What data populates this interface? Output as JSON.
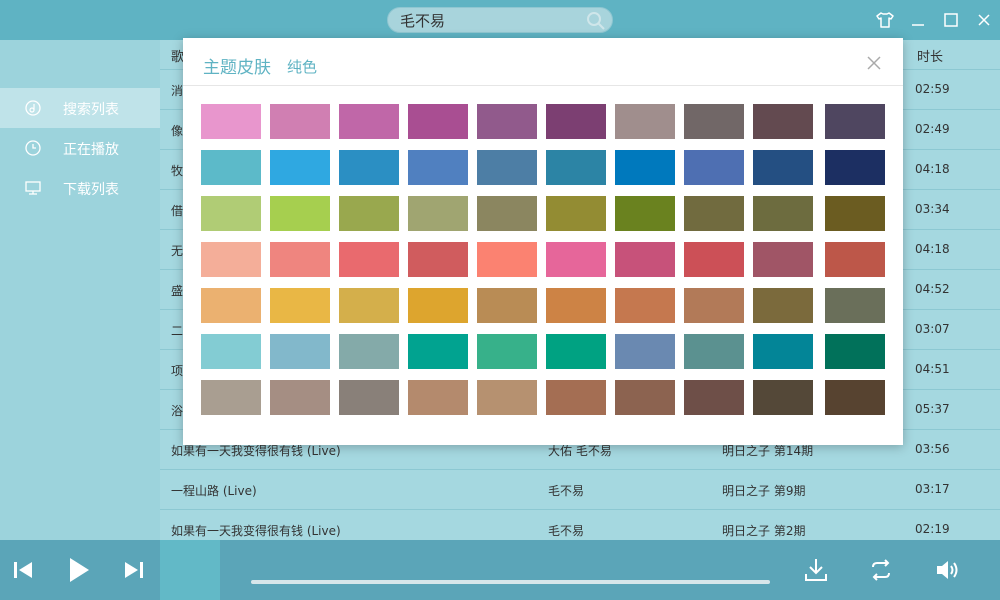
{
  "search": {
    "value": "毛不易"
  },
  "sidebar": {
    "items": [
      {
        "label": "搜索列表"
      },
      {
        "label": "正在播放"
      },
      {
        "label": "下载列表"
      }
    ]
  },
  "table": {
    "headers": {
      "song": "歌",
      "duration": "时长"
    },
    "rows": [
      {
        "title": "消",
        "artist": "",
        "album": "",
        "duration": "02:59"
      },
      {
        "title": "像",
        "artist": "",
        "album": "",
        "duration": "02:49"
      },
      {
        "title": "牧",
        "artist": "",
        "album": "",
        "duration": "04:18"
      },
      {
        "title": "借",
        "artist": "",
        "album": "",
        "duration": "03:34"
      },
      {
        "title": "无",
        "artist": "",
        "album": "",
        "duration": "04:18"
      },
      {
        "title": "盛",
        "artist": "",
        "album": "",
        "duration": "04:52"
      },
      {
        "title": "二",
        "artist": "",
        "album": "",
        "duration": "03:07"
      },
      {
        "title": "项",
        "artist": "",
        "album": "",
        "duration": "04:51"
      },
      {
        "title": "浴",
        "artist": "",
        "album": "",
        "duration": "05:37"
      },
      {
        "title": "如果有一天我变得很有钱 (Live)",
        "artist": "大佑 毛不易",
        "album": "明日之子 第14期",
        "duration": "03:56"
      },
      {
        "title": "一程山路 (Live)",
        "artist": "毛不易",
        "album": "明日之子 第9期",
        "duration": "03:17"
      },
      {
        "title": "如果有一天我变得很有钱 (Live)",
        "artist": "毛不易",
        "album": "明日之子 第2期",
        "duration": "02:19"
      }
    ]
  },
  "modal": {
    "title": "主题皮肤",
    "subtitle": "纯色",
    "swatches": [
      [
        "#e896cd",
        "#d07fb2",
        "#c067a8",
        "#a94e92",
        "#915a8c",
        "#7c3f72",
        "#a08e8d",
        "#716767",
        "#634a50",
        "#4f4660"
      ],
      [
        "#5cbac9",
        "#2fa8e1",
        "#2b8fc3",
        "#5080c0",
        "#4d7ea5",
        "#2c84a5",
        "#0079bd",
        "#4e6fb2",
        "#244f82",
        "#1c2f62"
      ],
      [
        "#b0cc75",
        "#a6cf4f",
        "#99a84e",
        "#a0a571",
        "#8b8660",
        "#938c33",
        "#6a821f",
        "#716b3f",
        "#6d6c3f",
        "#6b5c21"
      ],
      [
        "#f4ae99",
        "#ef857f",
        "#e96a6e",
        "#d05c5e",
        "#fb8271",
        "#e6669a",
        "#c7527a",
        "#cc5057",
        "#a05566",
        "#bd5749"
      ],
      [
        "#ebb170",
        "#e9b745",
        "#d4af4b",
        "#dda52e",
        "#b98c55",
        "#cd8345",
        "#c5784f",
        "#b27a58",
        "#7b6a3c",
        "#6a6f5a"
      ],
      [
        "#83ccd3",
        "#82b8cb",
        "#84aaa9",
        "#01a390",
        "#37b18a",
        "#00a282",
        "#6a89b1",
        "#5b9190",
        "#038597",
        "#01715a"
      ],
      [
        "#a99e91",
        "#a58e83",
        "#898079",
        "#b48a6d",
        "#b69170",
        "#a46e53",
        "#8c6350",
        "#6e4f48",
        "#544838",
        "#574330"
      ]
    ]
  },
  "colors": {
    "accent": "#5fb3c3",
    "sidebar": "#9cd3dc",
    "table": "#a5d8e0",
    "bottombar": "#5ba5b8"
  },
  "icons": {
    "skin": "shirt-icon",
    "minimize": "minimize-icon",
    "maximize": "maximize-icon",
    "close": "close-icon",
    "search": "search-icon",
    "prev": "previous-icon",
    "play": "play-icon",
    "next": "next-icon",
    "download": "download-icon",
    "loop": "loop-icon",
    "volume": "volume-icon"
  }
}
